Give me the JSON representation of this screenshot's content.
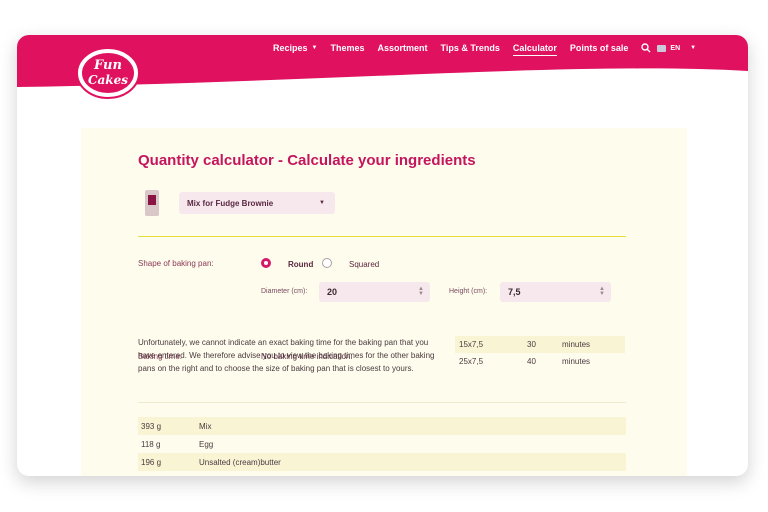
{
  "header": {
    "brand_color": "#e0115f",
    "logo_text": "Fun Cakes",
    "nav": [
      {
        "label": "Recipes",
        "has_dropdown": true
      },
      {
        "label": "Themes",
        "has_dropdown": false
      },
      {
        "label": "Assortment",
        "has_dropdown": false
      },
      {
        "label": "Tips & Trends",
        "has_dropdown": false
      },
      {
        "label": "Calculator",
        "has_dropdown": false,
        "active": true
      },
      {
        "label": "Points of sale",
        "has_dropdown": false
      }
    ],
    "language": "EN",
    "search_icon": "search-icon"
  },
  "calculator": {
    "title": "Quantity calculator - Calculate your ingredients",
    "product_select": "Mix for Fudge Brownie",
    "shape_label": "Shape of baking pan:",
    "shape_options": [
      "Round",
      "Squared"
    ],
    "shape_selected": "Round",
    "diameter_label": "Diameter (cm):",
    "diameter_value": "20",
    "height_label": "Height (cm):",
    "height_value": "7,5",
    "baking_time_label": "Baking time:",
    "baking_time_value": "No baking time indication.",
    "notice": "Unfortunately, we cannot indicate an exact baking time for the baking pan that you have entered. We therefore advise you to view the baking times for the other baking pans on the right and to choose the size of baking pan that is closest to yours.",
    "baking_times": [
      {
        "size": "15x7,5",
        "time": "30",
        "unit": "minutes"
      },
      {
        "size": "25x7,5",
        "time": "40",
        "unit": "minutes"
      }
    ],
    "ingredients": [
      {
        "amount": "393 g",
        "name": "Mix"
      },
      {
        "amount": "118 g",
        "name": "Egg"
      },
      {
        "amount": "196 g",
        "name": "Unsalted (cream)butter"
      }
    ]
  }
}
